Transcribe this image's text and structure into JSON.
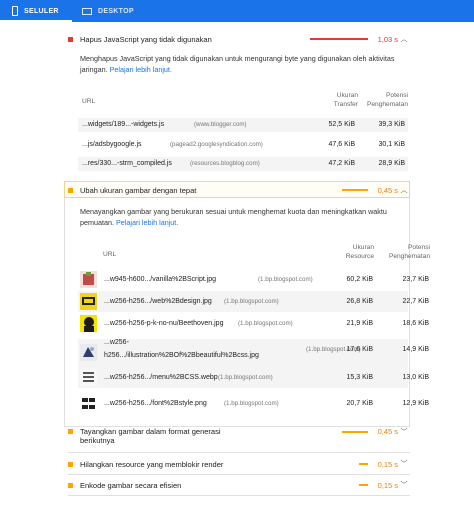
{
  "tabs": [
    {
      "label": "SELULER",
      "icon": "smartphone-icon",
      "active": true
    },
    {
      "label": "DESKTOP",
      "icon": "desktop-icon",
      "active": false
    }
  ],
  "colors": {
    "brand": "#1a73e8",
    "fail": "#e53935",
    "average": "#ffa400",
    "link": "#1a73e8"
  },
  "audit1": {
    "title": "Hapus JavaScript yang tidak digunakan",
    "savings": "1,03 s",
    "description": "Menghapus JavaScript yang tidak digunakan untuk mengurangi byte yang digunakan oleh aktivitas jaringan.",
    "link": "Pelajari lebih lanjut.",
    "columns": {
      "url": "URL",
      "transfer": "Ukuran Transfer",
      "savings": "Potensi Penghematan"
    },
    "rows": [
      {
        "url": "...widgets/189...-widgets.js",
        "host": "(www.blogger.com)",
        "transfer": "52,5 KiB",
        "savings": "39,3 KiB"
      },
      {
        "url": "...js/adsbygoogle.js",
        "host": "(pagead2.googlesyndication.com)",
        "transfer": "47,6 KiB",
        "savings": "30,1 KiB"
      },
      {
        "url": "...res/330...-strm_compiled.js",
        "host": "(resources.blogblog.com)",
        "transfer": "47,2 KiB",
        "savings": "28,9 KiB"
      }
    ]
  },
  "audit2": {
    "title": "Ubah ukuran gambar dengan tepat",
    "savings": "0,45 s",
    "description": "Menayangkan gambar yang berukuran sesuai untuk menghemat kuota dan meningkatkan waktu pemuatan.",
    "link": "Pelajari lebih lanjut.",
    "columns": {
      "url": "URL",
      "resource": "Ukuran Resource",
      "savings": "Potensi Penghematan"
    },
    "rows": [
      {
        "url": "...w945-h600.../vanilla%2BScript.jpg",
        "host": "(1.bp.blogspot.com)",
        "resource": "60,2 KiB",
        "savings": "23,7 KiB"
      },
      {
        "url": "...w256-h256.../web%2Bdesign.jpg",
        "host": "(1.bp.blogspot.com)",
        "resource": "26,8 KiB",
        "savings": "22,7 KiB"
      },
      {
        "url": "...w256-h256-p-k-no-nu/Beethoven.jpg",
        "host": "(1.bp.blogspot.com)",
        "resource": "21,9 KiB",
        "savings": "18,6 KiB"
      },
      {
        "url1": "...w256-",
        "url2": "h256.../illustration%2BOf%2Bbeautiful%2Bcss.jpg",
        "host": "(1.bp.blogspot.com)",
        "resource": "17,6 KiB",
        "savings": "14,9 KiB"
      },
      {
        "url": "...w256-h256.../menu%2BCSS.webp",
        "host": "(1.bp.blogspot.com)",
        "resource": "15,3 KiB",
        "savings": "13,0 KiB"
      },
      {
        "url": "...w256-h256.../font%2Bstyle.png",
        "host": "(1.bp.blogspot.com)",
        "resource": "20,7 KiB",
        "savings": "12,9 KiB"
      }
    ]
  },
  "audit3": {
    "title": "Tayangkan gambar dalam format generasi berikutnya",
    "savings": "0,45 s"
  },
  "audit4": {
    "title": "Hilangkan resource yang memblokir render",
    "savings": "0,15 s"
  },
  "audit5": {
    "title": "Enkode gambar secara efisien",
    "savings": "0,15 s"
  }
}
